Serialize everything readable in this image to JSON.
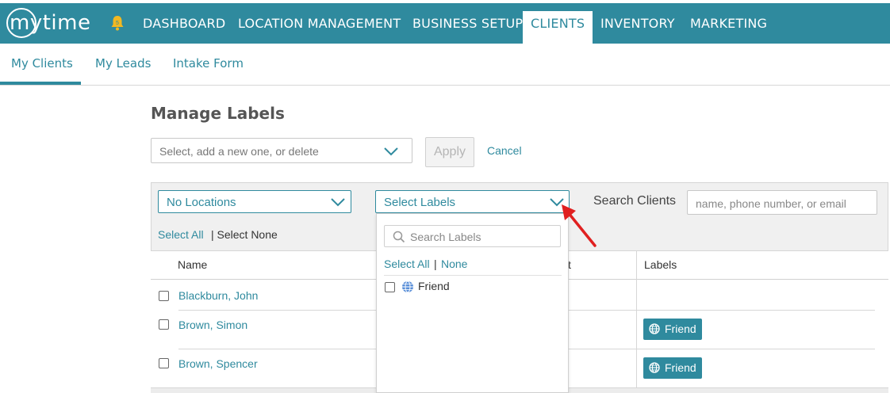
{
  "brand": {
    "logo_text": "mytime"
  },
  "nav": {
    "items": [
      "DASHBOARD",
      "LOCATION MANAGEMENT",
      "BUSINESS SETUP",
      "CLIENTS",
      "INVENTORY",
      "MARKETING"
    ],
    "active": "CLIENTS"
  },
  "subtabs": {
    "items": [
      "My Clients",
      "My Leads",
      "Intake Form"
    ],
    "active": "My Clients"
  },
  "manage_labels": {
    "title": "Manage Labels",
    "select_placeholder": "Select, add a new one, or delete",
    "apply_label": "Apply",
    "cancel_label": "Cancel"
  },
  "filters": {
    "locations_value": "No Locations",
    "labels_value": "Select Labels",
    "search_label": "Search Clients",
    "search_placeholder": "name, phone number, or email",
    "select_all": "Select All",
    "select_none": "| Select None"
  },
  "table": {
    "headers": {
      "name": "Name",
      "partial": "t",
      "labels": "Labels"
    },
    "rows": [
      {
        "name": "Blackburn, John",
        "label": ""
      },
      {
        "name": "Brown, Simon",
        "label": "Friend"
      },
      {
        "name": "Brown, Spencer",
        "label": "Friend"
      }
    ]
  },
  "labels_dropdown": {
    "search_placeholder": "Search Labels",
    "select_all": "Select All",
    "separator": "|",
    "none": "None",
    "options": [
      "Friend"
    ]
  },
  "colors": {
    "brand": "#2f8a9e",
    "annotation_arrow": "#e02020"
  }
}
